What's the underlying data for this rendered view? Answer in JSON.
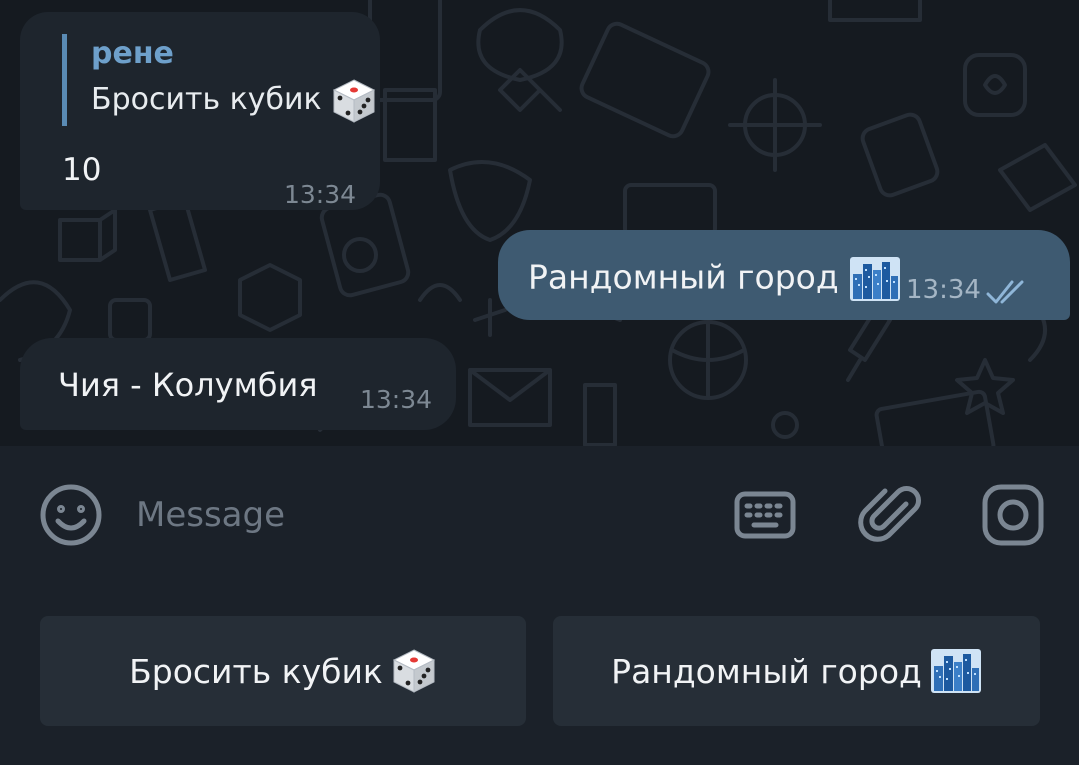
{
  "messages": [
    {
      "direction": "incoming",
      "reply_to": {
        "author": "рене",
        "text": "Бросить кубик",
        "emoji": "game-die"
      },
      "text": "10",
      "time": "13:34"
    },
    {
      "direction": "outgoing",
      "text": "Рандомный город",
      "emoji": "cityscape",
      "time": "13:34",
      "status": "read"
    },
    {
      "direction": "incoming",
      "text": "Чия - Колумбия",
      "time": "13:34"
    }
  ],
  "composer": {
    "placeholder": "Message",
    "icons": [
      "emoji-icon",
      "keyboard-icon",
      "attach-icon",
      "camera-icon"
    ]
  },
  "keyboard": {
    "buttons": [
      {
        "label": "Бросить кубик",
        "emoji": "game-die"
      },
      {
        "label": "Рандомный город",
        "emoji": "cityscape"
      }
    ]
  },
  "colors": {
    "chat_background": "#151a20",
    "incoming_bubble": "#1e252d",
    "outgoing_bubble": "#3e5a71",
    "reply_accent": "#6ea0cb",
    "panel_background": "#1b2129",
    "keyboard_button": "#262e37"
  }
}
